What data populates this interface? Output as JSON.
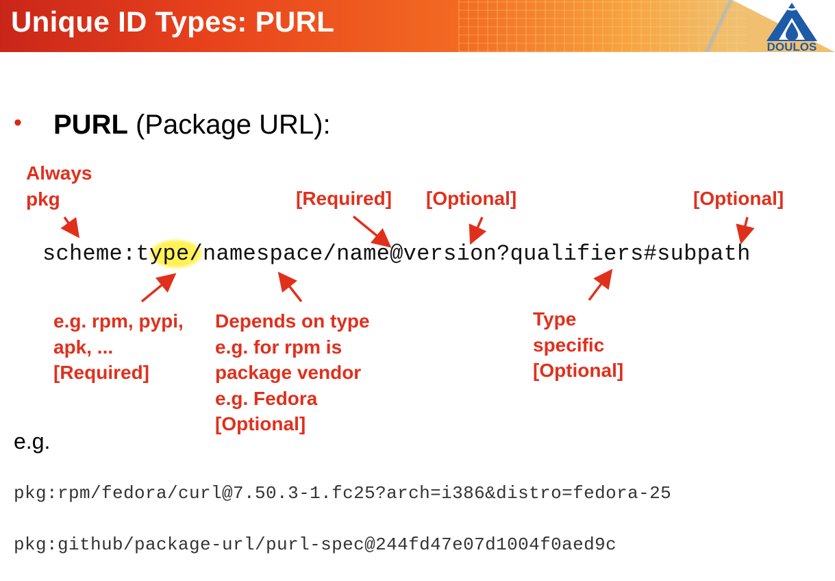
{
  "header": {
    "title": "Unique ID Types: PURL",
    "logo_text": "DOULOS",
    "colors": {
      "bar_start": "#c9261a",
      "bar_end": "#f7a340",
      "logo": "#1d5aa8"
    }
  },
  "bullet": {
    "term": "PURL",
    "description": " (Package URL):"
  },
  "syntax": {
    "pre": "scheme:t",
    "highlight": "ype/",
    "post": "namespace/name@version?qualifiers#subpath"
  },
  "annotations": {
    "scheme": "Always\npkg",
    "name": "[Required]",
    "version": "[Optional]",
    "subpath": "[Optional]",
    "type": "e.g. rpm, pypi,\napk, ...\n[Required]",
    "namespace": "Depends on type\ne.g. for rpm is\npackage vendor\ne.g. Fedora\n[Optional]",
    "qualifiers": "Type\nspecific\n[Optional]",
    "color": "#e0301c"
  },
  "examples": {
    "label": "e.g.",
    "items": [
      "pkg:rpm/fedora/curl@7.50.3-1.fc25?arch=i386&distro=fedora-25",
      "pkg:github/package-url/purl-spec@244fd47e07d1004f0aed9c"
    ]
  }
}
